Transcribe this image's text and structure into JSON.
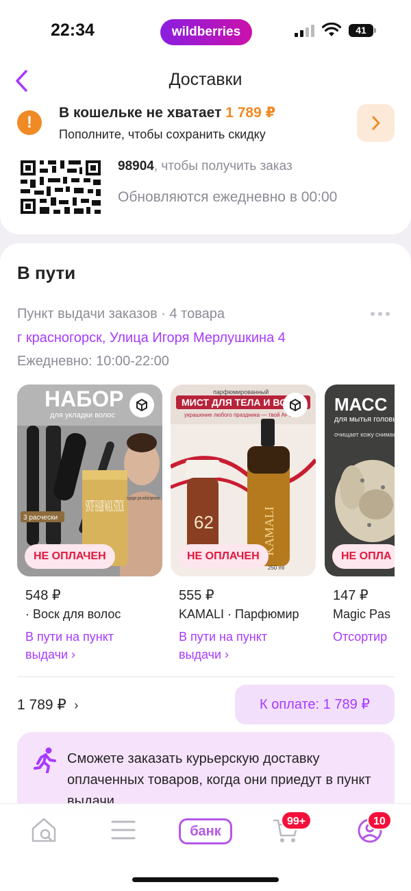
{
  "status_bar": {
    "time": "22:34",
    "brand": "wildberries",
    "battery": "41"
  },
  "header": {
    "title": "Доставки"
  },
  "wallet": {
    "title_prefix": "В кошельке не хватает ",
    "amount": "1 789 ₽",
    "subtitle": "Пополните, чтобы сохранить скидку"
  },
  "pickup_code": {
    "code": "98904",
    "code_suffix": ", чтобы получить заказ",
    "update_note": "Обновляются ежедневно в 00:00"
  },
  "in_transit": {
    "title": "В пути",
    "pickup_info": "Пункт выдачи заказов · 4 товара",
    "address": "г красногорск, Улица Игоря Мерлушкина 4",
    "hours": "Ежедневно: 10:00-22:00",
    "products": [
      {
        "badge": "НЕ ОПЛАЧЕН",
        "price": "548 ₽",
        "name": "· Воск для волос",
        "status": "В пути на пункт выдачи ›",
        "image_text": {
          "headline": "НАБОР",
          "sub": "для укладки волос",
          "combs": "3 расчески",
          "fits": "подходит для любой прически",
          "product": "SNTF HAIR WAX STICK"
        }
      },
      {
        "badge": "НЕ ОПЛАЧЕН",
        "price": "555 ₽",
        "name": "KAMALI · Парфюмир",
        "status": "В пути на пункт выдачи ›",
        "image_text": {
          "top": "парфюмированный",
          "headline": "МИСТ ДЛЯ ТЕЛА И ВО",
          "sub": "украшение любого праздника — твой АРО",
          "bottle": "KAMALI",
          "bottle_number": "62",
          "volume": "250 ml"
        }
      },
      {
        "badge": "НЕ ОПЛА",
        "price": "147 ₽",
        "name": "Magic Pas",
        "status": "Отсортир",
        "image_text": {
          "headline": "МАСС",
          "sub": "для мытья головы",
          "left": "очищает кожу",
          "right": "снимае усталос"
        }
      }
    ],
    "total": "1 789 ₽",
    "pay_button": "К оплате: 1 789 ₽",
    "courier_note": "Сможете заказать курьерскую доставку оплаченных товаров, когда они приедут в пункт выдачи"
  },
  "tabbar": {
    "items": [
      "home-search",
      "catalog",
      "bank",
      "cart",
      "profile"
    ],
    "bank_label": "банк",
    "cart_badge": "99+",
    "profile_badge": "10"
  },
  "colors": {
    "accent": "#a73afd",
    "warning": "#f08a24",
    "alert": "#e3173d"
  }
}
